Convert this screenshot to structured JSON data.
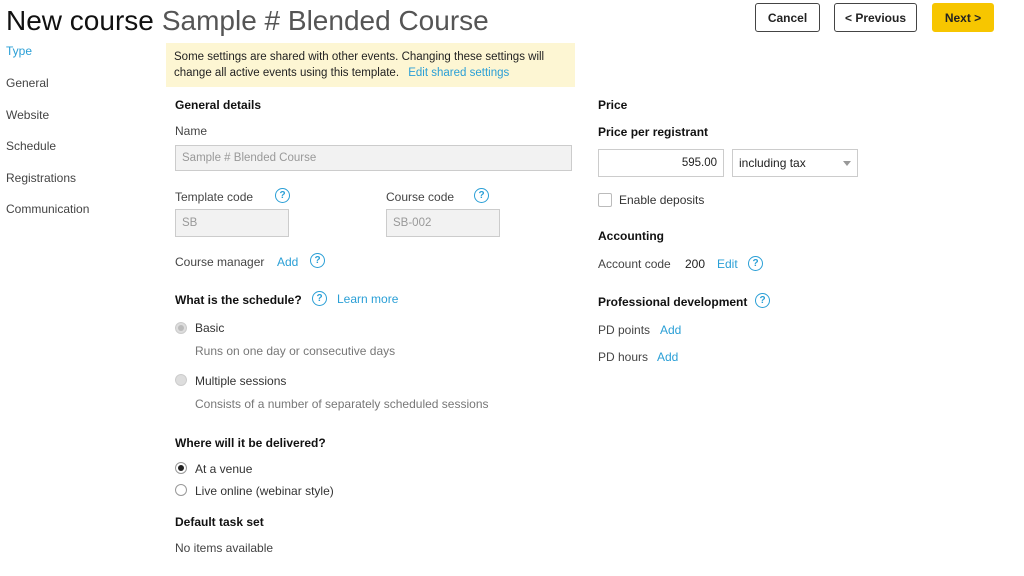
{
  "header": {
    "title": "New course",
    "subtitle": "Sample # Blended Course",
    "cancel_label": "Cancel",
    "previous_label": "< Previous",
    "next_label": "Next >"
  },
  "sidebar": {
    "items": [
      {
        "label": "Type",
        "active": true
      },
      {
        "label": "General",
        "active": false
      },
      {
        "label": "Website",
        "active": false
      },
      {
        "label": "Schedule",
        "active": false
      },
      {
        "label": "Registrations",
        "active": false
      },
      {
        "label": "Communication",
        "active": false
      }
    ]
  },
  "notice": {
    "text": "Some settings are shared with other events. Changing these settings will change all active events using this template.",
    "link": "Edit shared settings"
  },
  "general": {
    "heading": "General details",
    "name_label": "Name",
    "name_value": "Sample # Blended Course",
    "template_code_label": "Template code",
    "template_code_value": "SB",
    "course_code_label": "Course code",
    "course_code_value": "SB-002",
    "course_manager_label": "Course manager",
    "course_manager_link": "Add"
  },
  "schedule": {
    "heading": "What is the schedule?",
    "learn_more": "Learn more",
    "options": [
      {
        "label": "Basic",
        "description": "Runs on one day or consecutive days",
        "selected": true
      },
      {
        "label": "Multiple sessions",
        "description": "Consists of a number of separately scheduled sessions",
        "selected": false
      }
    ]
  },
  "delivery": {
    "heading": "Where will it be delivered?",
    "options": [
      {
        "label": "At a venue",
        "selected": true
      },
      {
        "label": "Live online (webinar style)",
        "selected": false
      }
    ]
  },
  "tasks": {
    "heading": "Default task set",
    "empty": "No items available"
  },
  "price": {
    "heading": "Price",
    "per_registrant_label": "Price per registrant",
    "amount": "595.00",
    "tax_option": "including tax",
    "deposits_label": "Enable deposits"
  },
  "accounting": {
    "heading": "Accounting",
    "account_code_label": "Account code",
    "account_code_value": "200",
    "edit_link": "Edit"
  },
  "pd": {
    "heading": "Professional development",
    "points_label": "PD points",
    "points_link": "Add",
    "hours_label": "PD hours",
    "hours_link": "Add"
  },
  "icons": {
    "help": "?",
    "help_icon": "question-circle-icon"
  },
  "colors": {
    "accent": "#2a9fd6",
    "next_button": "#f7c600",
    "notice_bg": "#fdf6d3"
  }
}
